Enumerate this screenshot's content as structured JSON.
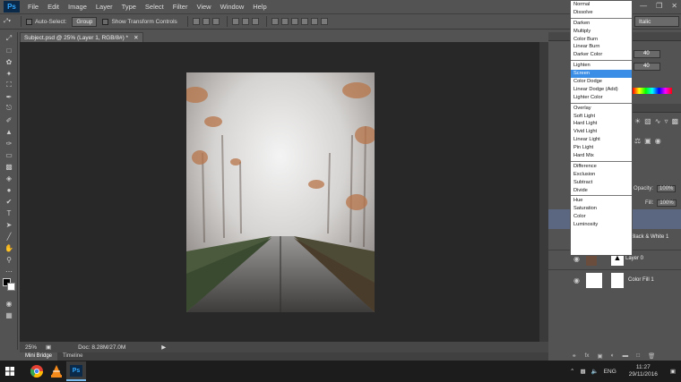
{
  "menubar": {
    "items": [
      "File",
      "Edit",
      "Image",
      "Layer",
      "Type",
      "Select",
      "Filter",
      "View",
      "Window",
      "Help"
    ],
    "app_logo": "Ps"
  },
  "options": {
    "auto_select_label": "Auto-Select:",
    "auto_select_value": "Group",
    "show_transform_label": "Show Transform Controls"
  },
  "document": {
    "tab_title": "Subject.psd @ 25% (Layer 1, RGB/8#) *",
    "zoom": "25%",
    "doc_size": "Doc: 8.28M/27.0M"
  },
  "bottom_tabs": [
    "Mini Bridge",
    "Timeline"
  ],
  "right_panel": {
    "font_style": "Italic",
    "color_value_1": "40",
    "color_value_2": "40",
    "opacity_label": "Opacity:",
    "opacity_value": "100%",
    "fill_label": "Fill:",
    "fill_value": "100%",
    "layers": [
      {
        "name": "Black & White 1"
      },
      {
        "name": "Layer 0"
      },
      {
        "name": "Color Fill 1"
      }
    ]
  },
  "blend_modes": {
    "groups": [
      [
        "Normal",
        "Dissolve"
      ],
      [
        "Darken",
        "Multiply",
        "Color Burn",
        "Linear Burn",
        "Darker Color"
      ],
      [
        "Lighten",
        "Screen",
        "Color Dodge",
        "Linear Dodge (Add)",
        "Lighter Color"
      ],
      [
        "Overlay",
        "Soft Light",
        "Hard Light",
        "Vivid Light",
        "Linear Light",
        "Pin Light",
        "Hard Mix"
      ],
      [
        "Difference",
        "Exclusion",
        "Subtract",
        "Divide"
      ],
      [
        "Hue",
        "Saturation",
        "Color",
        "Luminosity"
      ]
    ],
    "highlighted": "Screen",
    "highlight_color": "#3a8ee6"
  },
  "taskbar": {
    "lang": "ENG",
    "time": "11:27",
    "date": "29/11/2016"
  }
}
